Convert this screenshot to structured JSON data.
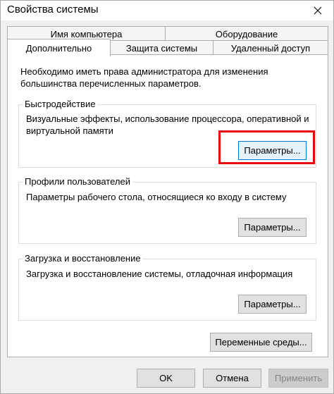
{
  "window": {
    "title": "Свойства системы"
  },
  "tabs": {
    "row1": [
      {
        "label": "Имя компьютера"
      },
      {
        "label": "Оборудование"
      }
    ],
    "row2": [
      {
        "label": "Дополнительно",
        "selected": true
      },
      {
        "label": "Защита системы"
      },
      {
        "label": "Удаленный доступ"
      }
    ]
  },
  "advanced": {
    "intro": "Необходимо иметь права администратора для изменения большинства перечисленных параметров.",
    "performance": {
      "title": "Быстродействие",
      "description": "Визуальные эффекты, использование процессора, оперативной и виртуальной памяти",
      "button": "Параметры..."
    },
    "profiles": {
      "title": "Профили пользователей",
      "description": "Параметры рабочего стола, относящиеся ко входу в систему",
      "button": "Параметры..."
    },
    "startup": {
      "title": "Загрузка и восстановление",
      "description": "Загрузка и восстановление системы, отладочная информация",
      "button": "Параметры..."
    },
    "env_button": "Переменные среды..."
  },
  "footer": {
    "ok": "OK",
    "cancel": "Отмена",
    "apply": "Применить"
  },
  "colors": {
    "highlight": "#e8060f",
    "focus": "#0078d7"
  },
  "icons": {
    "close": "close-icon"
  }
}
